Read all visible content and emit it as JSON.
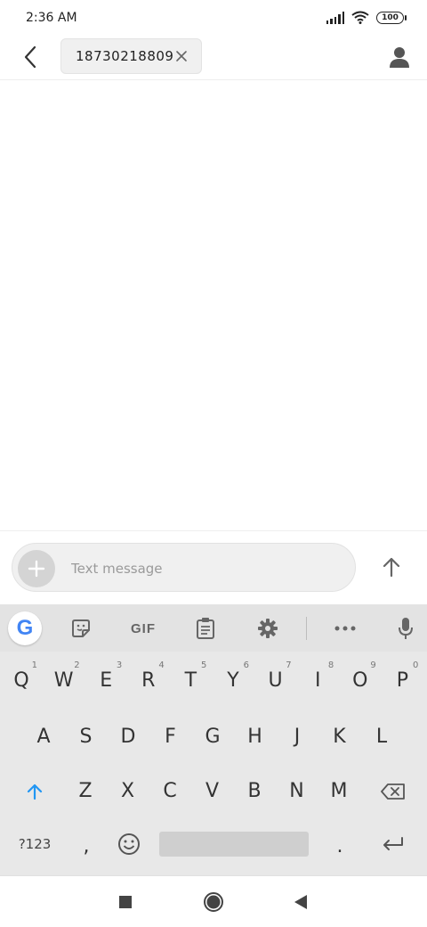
{
  "status_bar": {
    "time": "2:36 AM",
    "battery": "100",
    "icons": [
      "signal-icon",
      "wifi-icon",
      "battery-icon"
    ]
  },
  "header": {
    "recipient": "18730218809",
    "icons": [
      "back-arrow-icon",
      "close-icon",
      "contact-person-icon"
    ]
  },
  "compose": {
    "placeholder": "Text message",
    "value": "",
    "icons": [
      "plus-icon",
      "send-arrow-icon"
    ]
  },
  "keyboard": {
    "toolbar": {
      "items": [
        "google-g-icon",
        "sticker-icon",
        "gif-icon",
        "clipboard-icon",
        "settings-gear-icon",
        "more-dots-icon",
        "microphone-icon"
      ],
      "gif_label": "GIF",
      "google_label": "G"
    },
    "row1": [
      "Q",
      "W",
      "E",
      "R",
      "T",
      "Y",
      "U",
      "I",
      "O",
      "P"
    ],
    "row1_hints": [
      "1",
      "2",
      "3",
      "4",
      "5",
      "6",
      "7",
      "8",
      "9",
      "0"
    ],
    "row2": [
      "A",
      "S",
      "D",
      "F",
      "G",
      "H",
      "J",
      "K",
      "L"
    ],
    "row3": [
      "Z",
      "X",
      "C",
      "V",
      "B",
      "N",
      "M"
    ],
    "symbols_label": "?123",
    "comma": ",",
    "period": ".",
    "accent_color": "#2196F3"
  },
  "nav_bar": {
    "icons": [
      "recents-square-icon",
      "home-circle-icon",
      "back-triangle-icon"
    ]
  }
}
